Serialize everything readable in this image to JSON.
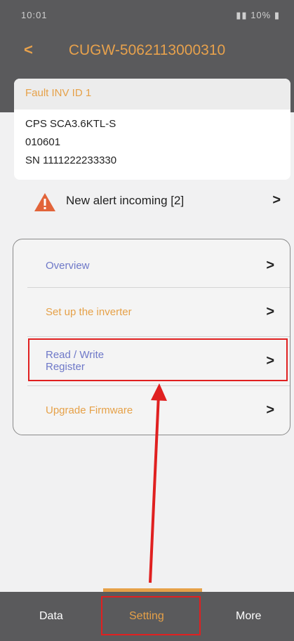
{
  "status_bar": {
    "time": "10:01",
    "right": "▮▮ 10% ▮"
  },
  "header": {
    "back_glyph": "<",
    "title": "CUGW-5062113000310"
  },
  "inverter_card": {
    "fault_label": "Fault INV ID 1",
    "model": "CPS SCA3.6KTL-S",
    "code": "010601",
    "serial": "SN 1111222233330"
  },
  "alert": {
    "label": "New alert incoming [2]",
    "icon": "warning-triangle-icon"
  },
  "menu": {
    "items": [
      {
        "label": "Overview",
        "color": "#6e78c8"
      },
      {
        "label": "Set up the inverter",
        "color": "#e6a148"
      },
      {
        "label_line1": "Read / Write",
        "label_line2": "Register",
        "color": "#6e78c8"
      },
      {
        "label": "Upgrade Firmware",
        "color": "#e6a148"
      }
    ],
    "chevron": ">"
  },
  "bottom_tabs": {
    "data": "Data",
    "setting": "Setting",
    "more": "More",
    "active": "Setting"
  },
  "colors": {
    "accent": "#e6a148",
    "highlight": "#e02020",
    "bar": "#5a5a5c"
  }
}
